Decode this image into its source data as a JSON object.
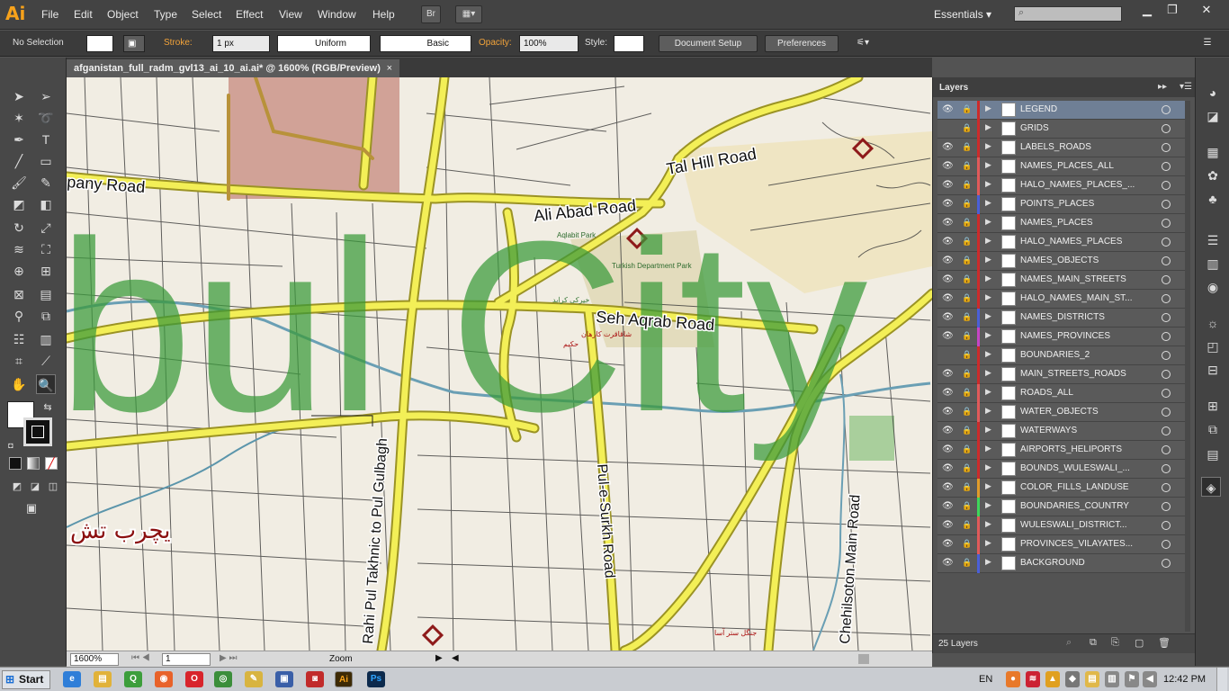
{
  "app": {
    "logo": "Ai"
  },
  "menu": [
    "File",
    "Edit",
    "Object",
    "Type",
    "Select",
    "Effect",
    "View",
    "Window",
    "Help"
  ],
  "menubar_extra": {
    "bridge": "Br",
    "workspace": "Essentials"
  },
  "control": {
    "selection": "No Selection",
    "stroke_label": "Stroke:",
    "stroke_value": "1 px",
    "profile": "Uniform",
    "brush": "Basic",
    "opacity_label": "Opacity:",
    "opacity_value": "100%",
    "style_label": "Style:",
    "doc_setup": "Document Setup",
    "preferences": "Preferences"
  },
  "document": {
    "tab": "afganistan_full_radm_gvl13_ai_10_ai.ai* @ 1600% (RGB/Preview)",
    "close": "×"
  },
  "map_labels": {
    "watermark": "bul City",
    "road1": "pany Road",
    "road2": "Ali Abad Road",
    "road3": "Tal Hill Road",
    "road4": "Seh Aqrab Road",
    "road5": "Rahi Pul Takhnic to Pul Gulbagh",
    "road6": "Pul-e-Surkh Road",
    "road7": "Chehilsoton Main Road",
    "place1": "Aqlabit Park",
    "place2": "Turkish Department Park",
    "arabic1": "یچرب تش",
    "arabic2": "شاقاقرت کارهان",
    "arabic3": "حکیم",
    "arabic4": "خیرکی کرابد",
    "arabic5": "جنگل ستر آسا"
  },
  "status": {
    "zoom": "1600%",
    "page": "1",
    "tool": "Zoom"
  },
  "layers_panel": {
    "title": "Layers",
    "count": "25 Layers",
    "layers": [
      {
        "name": "LEGEND",
        "color": "#cc2b2b",
        "visible": true
      },
      {
        "name": "GRIDS",
        "color": "#cc2b2b",
        "visible": false
      },
      {
        "name": "LABELS_ROADS",
        "color": "#cc2b2b",
        "visible": true
      },
      {
        "name": "NAMES_PLACES_ALL",
        "color": "#e05a5a",
        "visible": true
      },
      {
        "name": "HALO_NAMES_PLACES_...",
        "color": "#e05a5a",
        "visible": true
      },
      {
        "name": "POINTS_PLACES",
        "color": "#4a5fd8",
        "visible": true
      },
      {
        "name": "NAMES_PLACES",
        "color": "#cc2b2b",
        "visible": true
      },
      {
        "name": "HALO_NAMES_PLACES",
        "color": "#cc2b2b",
        "visible": true
      },
      {
        "name": "NAMES_OBJECTS",
        "color": "#cc2b2b",
        "visible": true
      },
      {
        "name": "NAMES_MAIN_STREETS",
        "color": "#cc2b2b",
        "visible": true
      },
      {
        "name": "HALO_NAMES_MAIN_ST...",
        "color": "#cc2b2b",
        "visible": true
      },
      {
        "name": "NAMES_DISTRICTS",
        "color": "#4a5fd8",
        "visible": true
      },
      {
        "name": "NAMES_PROVINCES",
        "color": "#c545c5",
        "visible": true
      },
      {
        "name": "BOUNDARIES_2",
        "color": "#cc2b2b",
        "visible": false
      },
      {
        "name": "MAIN_STREETS_ROADS",
        "color": "#cc2b2b",
        "visible": true
      },
      {
        "name": "ROADS_ALL",
        "color": "#e05a5a",
        "visible": true
      },
      {
        "name": "WATER_OBJECTS",
        "color": "#e05a5a",
        "visible": true
      },
      {
        "name": "WATERWAYS",
        "color": "#cc2b2b",
        "visible": true
      },
      {
        "name": "AIRPORTS_HELIPORTS",
        "color": "#cc2b2b",
        "visible": true
      },
      {
        "name": "BOUNDS_WULESWALI_...",
        "color": "#cc2b2b",
        "visible": true
      },
      {
        "name": "COLOR_FILLS_LANDUSE",
        "color": "#e09b2a",
        "visible": true
      },
      {
        "name": "BOUNDARIES_COUNTRY",
        "color": "#3ed65a",
        "visible": true
      },
      {
        "name": "WULESWALI_DISTRICT...",
        "color": "#e05a5a",
        "visible": true
      },
      {
        "name": "PROVINCES_VILAYATES...",
        "color": "#e05a5a",
        "visible": true
      },
      {
        "name": "BACKGROUND",
        "color": "#4a5fd8",
        "visible": true
      }
    ]
  },
  "taskbar": {
    "start": "Start",
    "lang": "EN",
    "time": "12:42 PM"
  }
}
